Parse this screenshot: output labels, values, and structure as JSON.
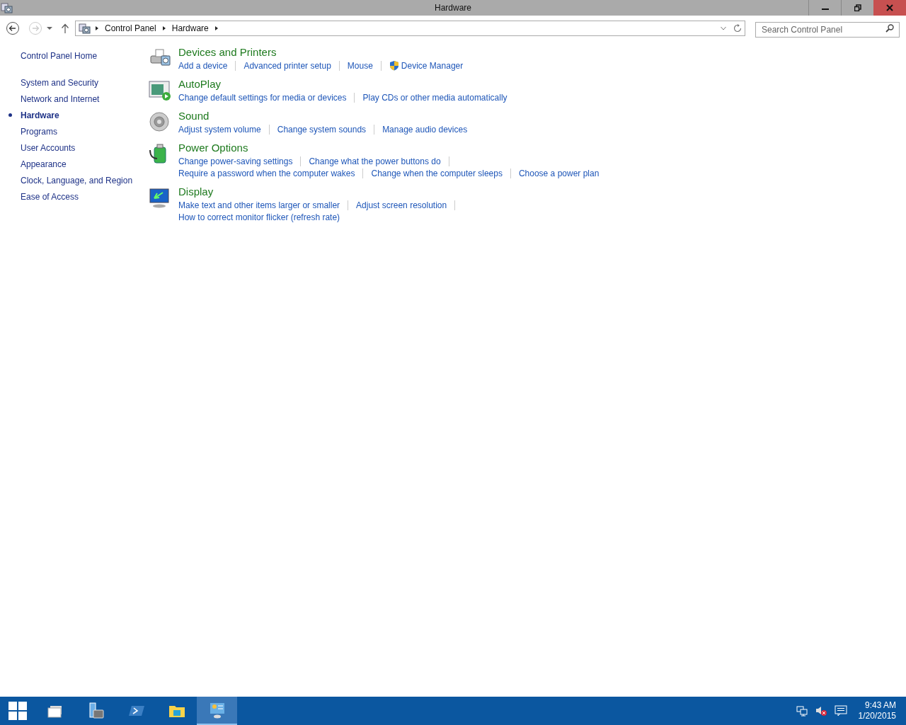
{
  "window": {
    "title": "Hardware"
  },
  "address_bar": {
    "crumbs": [
      "Control Panel",
      "Hardware"
    ]
  },
  "search": {
    "placeholder": "Search Control Panel"
  },
  "sidebar": {
    "home": "Control Panel Home",
    "items": [
      {
        "label": "System and Security",
        "selected": false
      },
      {
        "label": "Network and Internet",
        "selected": false
      },
      {
        "label": "Hardware",
        "selected": true
      },
      {
        "label": "Programs",
        "selected": false
      },
      {
        "label": "User Accounts",
        "selected": false
      },
      {
        "label": "Appearance",
        "selected": false
      },
      {
        "label": "Clock, Language, and Region",
        "selected": false
      },
      {
        "label": "Ease of Access",
        "selected": false
      }
    ]
  },
  "sections": [
    {
      "kind": "printer",
      "title": "Devices and Printers",
      "link_rows": [
        [
          {
            "label": "Add a device"
          },
          {
            "label": "Advanced printer setup"
          },
          {
            "label": "Mouse"
          },
          {
            "label": "Device Manager",
            "shield": true
          }
        ]
      ]
    },
    {
      "kind": "autoplay",
      "title": "AutoPlay",
      "link_rows": [
        [
          {
            "label": "Change default settings for media or devices"
          },
          {
            "label": "Play CDs or other media automatically"
          }
        ]
      ]
    },
    {
      "kind": "sound",
      "title": "Sound",
      "link_rows": [
        [
          {
            "label": "Adjust system volume"
          },
          {
            "label": "Change system sounds"
          },
          {
            "label": "Manage audio devices"
          }
        ]
      ]
    },
    {
      "kind": "power",
      "title": "Power Options",
      "link_rows": [
        [
          {
            "label": "Change power-saving settings"
          },
          {
            "label": "Change what the power buttons do"
          }
        ],
        [
          {
            "label": "Require a password when the computer wakes"
          },
          {
            "label": "Change when the computer sleeps"
          },
          {
            "label": "Choose a power plan"
          }
        ]
      ]
    },
    {
      "kind": "display",
      "title": "Display",
      "link_rows": [
        [
          {
            "label": "Make text and other items larger or smaller"
          },
          {
            "label": "Adjust screen resolution"
          }
        ],
        [
          {
            "label": "How to correct monitor flicker (refresh rate)"
          }
        ]
      ]
    }
  ],
  "taskbar": {
    "apps": [
      {
        "kind": "taskview",
        "selected": false
      },
      {
        "kind": "servermanager",
        "selected": false
      },
      {
        "kind": "powershell",
        "selected": false
      },
      {
        "kind": "explorer",
        "selected": false
      },
      {
        "kind": "controlpanel",
        "selected": true
      }
    ],
    "time": "9:43 AM",
    "date": "1/20/2015"
  }
}
